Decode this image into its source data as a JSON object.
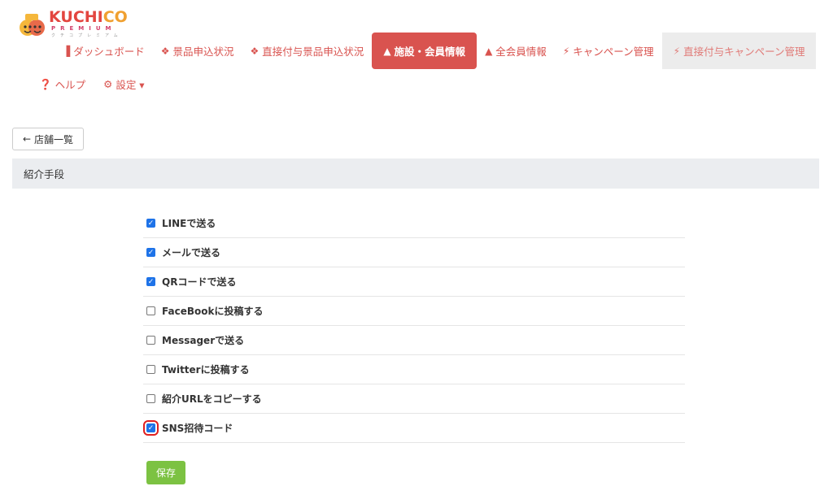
{
  "brand": {
    "name_part1": "KUCHI",
    "name_part2": "CO",
    "tag": "PREMIUM",
    "tag_sub": "クチコプレミアム"
  },
  "nav": [
    {
      "icon": "bar-chart-icon",
      "glyph": "▐",
      "label": "ダッシュボード"
    },
    {
      "icon": "gift-icon",
      "glyph": "❖",
      "label": "景品申込状況"
    },
    {
      "icon": "gift-icon",
      "glyph": "❖",
      "label": "直接付与景品申込状況"
    },
    {
      "icon": "user-icon",
      "glyph": "▲",
      "label": "施設・会員情報",
      "active": true
    },
    {
      "icon": "user-icon",
      "glyph": "▲",
      "label": "全会員情報"
    },
    {
      "icon": "lightning-icon",
      "glyph": "⚡",
      "label": "キャンペーン管理"
    },
    {
      "icon": "lightning-icon",
      "glyph": "⚡",
      "label": "直接付与キャンペーン管理"
    }
  ],
  "nav2": {
    "help": {
      "icon": "help-icon",
      "glyph": "❓",
      "label": "ヘルプ"
    },
    "settings": {
      "icon": "gear-icon",
      "glyph": "⚙",
      "label": "設定 ▾"
    }
  },
  "back_button": {
    "icon": "arrow-left-icon",
    "glyph": "←",
    "label": "店舗一覧"
  },
  "section_title": "紹介手段",
  "options": [
    {
      "label": "LINEで送る",
      "checked": true
    },
    {
      "label": "メールで送る",
      "checked": true
    },
    {
      "label": "QRコードで送る",
      "checked": true
    },
    {
      "label": "FaceBookに投稿する",
      "checked": false
    },
    {
      "label": "Messagerで送る",
      "checked": false
    },
    {
      "label": "Twitterに投稿する",
      "checked": false
    },
    {
      "label": "紹介URLをコピーする",
      "checked": false
    },
    {
      "label": "SNS招待コード",
      "checked": true,
      "highlighted": true
    }
  ],
  "save_label": "保存",
  "colors": {
    "accent": "#d9534f",
    "checkbox": "#1e73e8",
    "save": "#7cc242",
    "highlight": "#e02020"
  }
}
